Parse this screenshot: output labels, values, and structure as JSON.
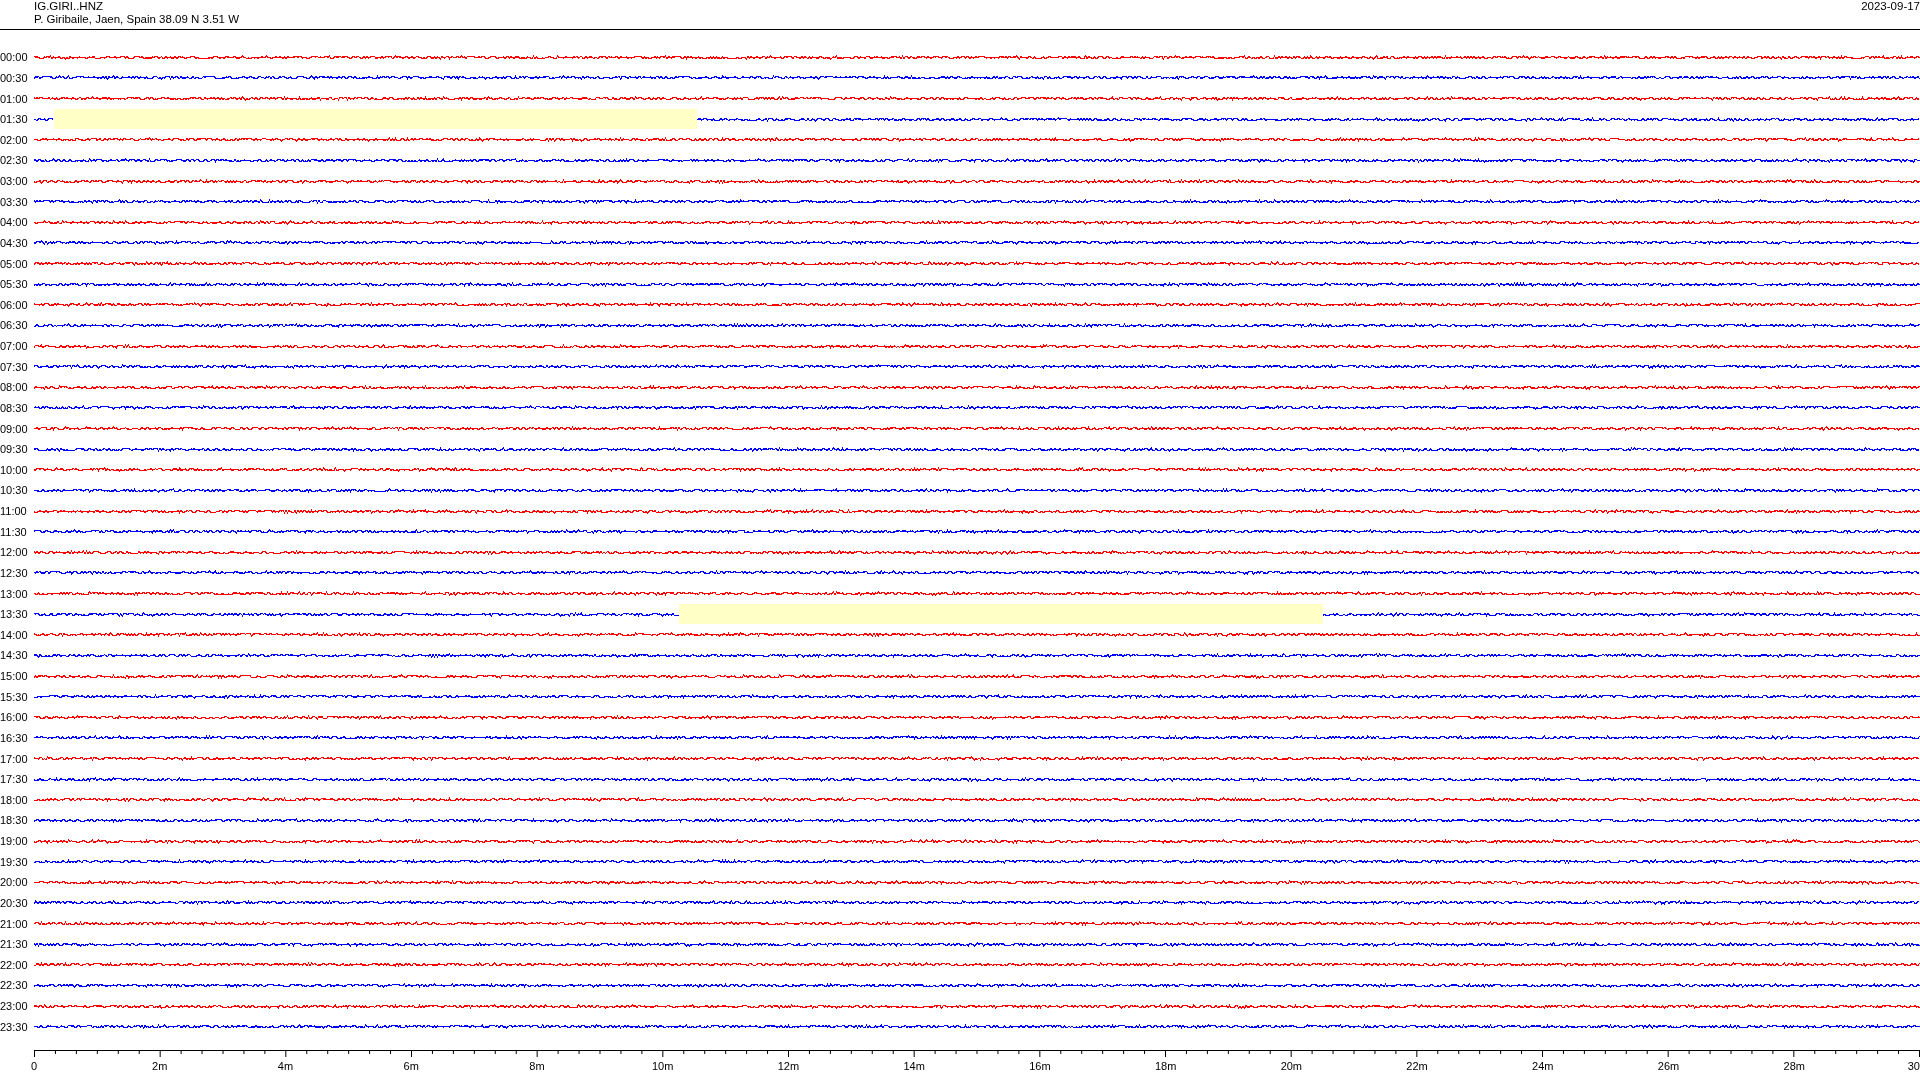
{
  "header": {
    "station": "IG.GIRI..HNZ",
    "location": "P. Giribaile, Jaen, Spain  38.09 N 3.51 W",
    "date": "2023-09-17"
  },
  "rows": [
    {
      "label": "00:00",
      "color": "#ff0000"
    },
    {
      "label": "00:30",
      "color": "#0000ff"
    },
    {
      "label": "01:00",
      "color": "#ff0000"
    },
    {
      "label": "01:30",
      "color": "#0000ff"
    },
    {
      "label": "02:00",
      "color": "#ff0000"
    },
    {
      "label": "02:30",
      "color": "#0000ff"
    },
    {
      "label": "03:00",
      "color": "#ff0000"
    },
    {
      "label": "03:30",
      "color": "#0000ff"
    },
    {
      "label": "04:00",
      "color": "#ff0000"
    },
    {
      "label": "04:30",
      "color": "#0000ff"
    },
    {
      "label": "05:00",
      "color": "#ff0000"
    },
    {
      "label": "05:30",
      "color": "#0000ff"
    },
    {
      "label": "06:00",
      "color": "#ff0000"
    },
    {
      "label": "06:30",
      "color": "#0000ff"
    },
    {
      "label": "07:00",
      "color": "#ff0000"
    },
    {
      "label": "07:30",
      "color": "#0000ff"
    },
    {
      "label": "08:00",
      "color": "#ff0000"
    },
    {
      "label": "08:30",
      "color": "#0000ff"
    },
    {
      "label": "09:00",
      "color": "#ff0000"
    },
    {
      "label": "09:30",
      "color": "#0000ff"
    },
    {
      "label": "10:00",
      "color": "#ff0000"
    },
    {
      "label": "10:30",
      "color": "#0000ff"
    },
    {
      "label": "11:00",
      "color": "#ff0000"
    },
    {
      "label": "11:30",
      "color": "#0000ff"
    },
    {
      "label": "12:00",
      "color": "#ff0000"
    },
    {
      "label": "12:30",
      "color": "#0000ff"
    },
    {
      "label": "13:00",
      "color": "#ff0000"
    },
    {
      "label": "13:30",
      "color": "#0000ff"
    },
    {
      "label": "14:00",
      "color": "#ff0000"
    },
    {
      "label": "14:30",
      "color": "#0000ff"
    },
    {
      "label": "15:00",
      "color": "#ff0000"
    },
    {
      "label": "15:30",
      "color": "#0000ff"
    },
    {
      "label": "16:00",
      "color": "#ff0000"
    },
    {
      "label": "16:30",
      "color": "#0000ff"
    },
    {
      "label": "17:00",
      "color": "#ff0000"
    },
    {
      "label": "17:30",
      "color": "#0000ff"
    },
    {
      "label": "18:00",
      "color": "#ff0000"
    },
    {
      "label": "18:30",
      "color": "#0000ff"
    },
    {
      "label": "19:00",
      "color": "#ff0000"
    },
    {
      "label": "19:30",
      "color": "#0000ff"
    },
    {
      "label": "20:00",
      "color": "#ff0000"
    },
    {
      "label": "20:30",
      "color": "#0000ff"
    },
    {
      "label": "21:00",
      "color": "#ff0000"
    },
    {
      "label": "21:30",
      "color": "#0000ff"
    },
    {
      "label": "22:00",
      "color": "#ff0000"
    },
    {
      "label": "22:30",
      "color": "#0000ff"
    },
    {
      "label": "23:00",
      "color": "#ff0000"
    },
    {
      "label": "23:30",
      "color": "#0000ff"
    }
  ],
  "axis": {
    "labels": [
      "0",
      "2m",
      "4m",
      "6m",
      "8m",
      "10m",
      "12m",
      "14m",
      "16m",
      "18m",
      "20m",
      "22m",
      "24m",
      "26m",
      "28m",
      "30"
    ]
  }
}
